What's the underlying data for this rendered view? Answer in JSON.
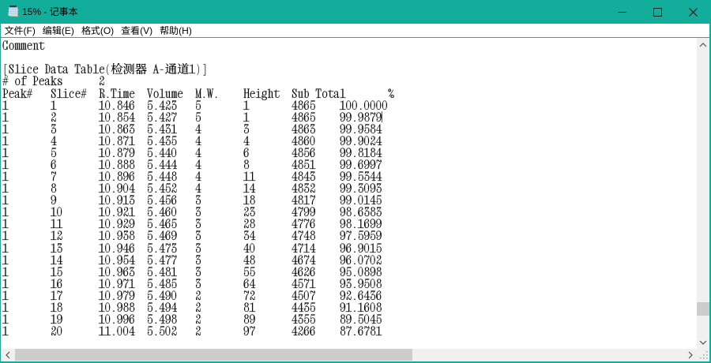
{
  "window": {
    "title": "15% - 记事本",
    "accent_color": "#12AE9B"
  },
  "titlebar": {
    "icon": "notepad",
    "controls": [
      "minimize",
      "maximize",
      "close"
    ]
  },
  "menu_bar": {
    "items": [
      "文件(F)",
      "编辑(E)",
      "格式(O)",
      "查看(V)",
      "帮助(H)"
    ]
  },
  "document": {
    "comment": "Comment",
    "section_title": "[Slice Data Table(检测器 A-通道1)]",
    "peaks_label": "# of Peaks",
    "peaks_count": "2",
    "table": {
      "columns": [
        "Peak#",
        "Slice#",
        "R.Time",
        "Volume",
        "M.W.",
        "Height",
        "Sub Total",
        "%"
      ],
      "rows": [
        [
          "1",
          "1",
          "10.846",
          "5.423",
          "5",
          "1",
          "4865",
          "100.0000"
        ],
        [
          "1",
          "2",
          "10.854",
          "5.427",
          "5",
          "1",
          "4865",
          "99.9879"
        ],
        [
          "1",
          "3",
          "10.863",
          "5.431",
          "4",
          "3",
          "4863",
          "99.9584"
        ],
        [
          "1",
          "4",
          "10.871",
          "5.435",
          "4",
          "4",
          "4860",
          "99.9024"
        ],
        [
          "1",
          "5",
          "10.879",
          "5.440",
          "4",
          "6",
          "4856",
          "99.8184"
        ],
        [
          "1",
          "6",
          "10.888",
          "5.444",
          "4",
          "8",
          "4851",
          "99.6997"
        ],
        [
          "1",
          "7",
          "10.896",
          "5.448",
          "4",
          "11",
          "4843",
          "99.5344"
        ],
        [
          "1",
          "8",
          "10.904",
          "5.452",
          "4",
          "14",
          "4832",
          "99.3093"
        ],
        [
          "1",
          "9",
          "10.913",
          "5.456",
          "3",
          "18",
          "4817",
          "99.0145"
        ],
        [
          "1",
          "10",
          "10.921",
          "5.460",
          "3",
          "23",
          "4799",
          "98.6383"
        ],
        [
          "1",
          "11",
          "10.929",
          "5.465",
          "3",
          "28",
          "4776",
          "98.1699"
        ],
        [
          "1",
          "12",
          "10.938",
          "5.469",
          "3",
          "34",
          "4748",
          "97.5959"
        ],
        [
          "1",
          "13",
          "10.946",
          "5.473",
          "3",
          "40",
          "4714",
          "96.9015"
        ],
        [
          "1",
          "14",
          "10.954",
          "5.477",
          "3",
          "48",
          "4674",
          "96.0702"
        ],
        [
          "1",
          "15",
          "10.963",
          "5.481",
          "3",
          "55",
          "4626",
          "95.0898"
        ],
        [
          "1",
          "16",
          "10.971",
          "5.485",
          "3",
          "64",
          "4571",
          "93.9508"
        ],
        [
          "1",
          "17",
          "10.979",
          "5.490",
          "2",
          "72",
          "4507",
          "92.6436"
        ],
        [
          "1",
          "18",
          "10.988",
          "5.494",
          "2",
          "81",
          "4435",
          "91.1608"
        ],
        [
          "1",
          "19",
          "10.996",
          "5.498",
          "2",
          "89",
          "4355",
          "89.5045"
        ],
        [
          "1",
          "20",
          "11.004",
          "5.502",
          "2",
          "97",
          "4266",
          "87.6781"
        ]
      ]
    },
    "caret": {
      "line": 7,
      "col": 63
    },
    "tab_stop": 8
  }
}
